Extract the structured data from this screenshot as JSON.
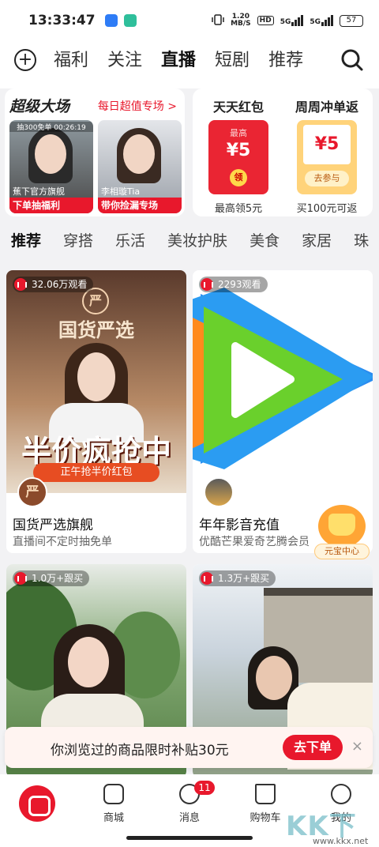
{
  "status": {
    "time": "13:33:47",
    "speed_value": "1.20",
    "speed_unit": "MB/S",
    "hd": "HD",
    "net1": "5G",
    "net2": "5G",
    "battery": "57"
  },
  "topnav": {
    "tabs": [
      "福利",
      "关注",
      "直播",
      "短剧",
      "推荐"
    ],
    "active": "直播"
  },
  "promo_left": {
    "title": "超级大场",
    "link": "每日超值专场 >",
    "items": [
      {
        "tag": "抽300免单 00:26:19",
        "host": "蕉下官方旗舰",
        "banner": "下单抽福利"
      },
      {
        "tag": "",
        "host": "李相璇Tia",
        "banner": "带你捡漏专场"
      }
    ]
  },
  "promo_right": {
    "items": [
      {
        "title": "天天红包",
        "label": "最高",
        "amount": "¥5",
        "seal": "领",
        "sub": "最高领5元"
      },
      {
        "title": "周周冲单返",
        "amount": "¥5",
        "button": "去参与",
        "sub": "买100元可返"
      }
    ]
  },
  "categories": [
    "推荐",
    "穿搭",
    "乐活",
    "美妆护肤",
    "美食",
    "家居",
    "珠"
  ],
  "feed": [
    {
      "viewers": "32.06万观看",
      "poster_brand": "国货严选",
      "poster_headline": "半价疯抢中",
      "poster_sub": "正午抢半价红包",
      "name": "国货严选旗舰",
      "sub": "直播间不定时抽免单",
      "avatar_text": "严"
    },
    {
      "viewers": "2293观看",
      "name": "年年影音充值",
      "sub": "优酷芒果爱奇艺腾会员"
    },
    {
      "viewers": "1.0万+跟买"
    },
    {
      "viewers": "1.3万+跟买"
    }
  ],
  "yuanbao": {
    "label": "元宝中心"
  },
  "subsidy": {
    "text": "你浏览过的商品限时补贴30元",
    "button": "去下单",
    "close": "×"
  },
  "bottom": {
    "items": [
      "商城",
      "消息",
      "购物车",
      "我的"
    ],
    "badge": "11"
  },
  "watermark": {
    "text": "KK下载",
    "url": "www.kkx.net"
  }
}
